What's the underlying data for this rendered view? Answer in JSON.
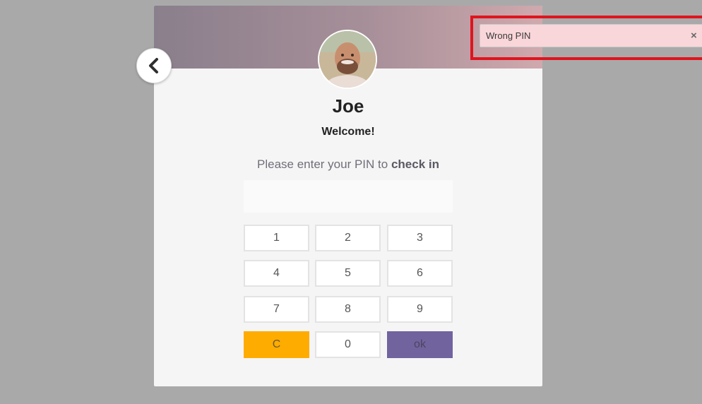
{
  "employee": {
    "name": "Joe",
    "greeting": "Welcome!"
  },
  "pin_prompt": {
    "text": "Please enter your PIN to",
    "action": "check in"
  },
  "pin_field": {
    "value": "",
    "placeholder": ""
  },
  "keypad": {
    "keys": [
      "1",
      "2",
      "3",
      "4",
      "5",
      "6",
      "7",
      "8",
      "9",
      "C",
      "0",
      "ok"
    ]
  },
  "notification": {
    "message": "Wrong PIN",
    "close_label": "×"
  },
  "icons": {
    "back": "chevron-left-icon",
    "close": "close-icon"
  },
  "colors": {
    "clear_key": "#ffac00",
    "ok_key": "#71639e",
    "toast_bg": "#f9d6d9",
    "highlight": "#e0141e"
  }
}
